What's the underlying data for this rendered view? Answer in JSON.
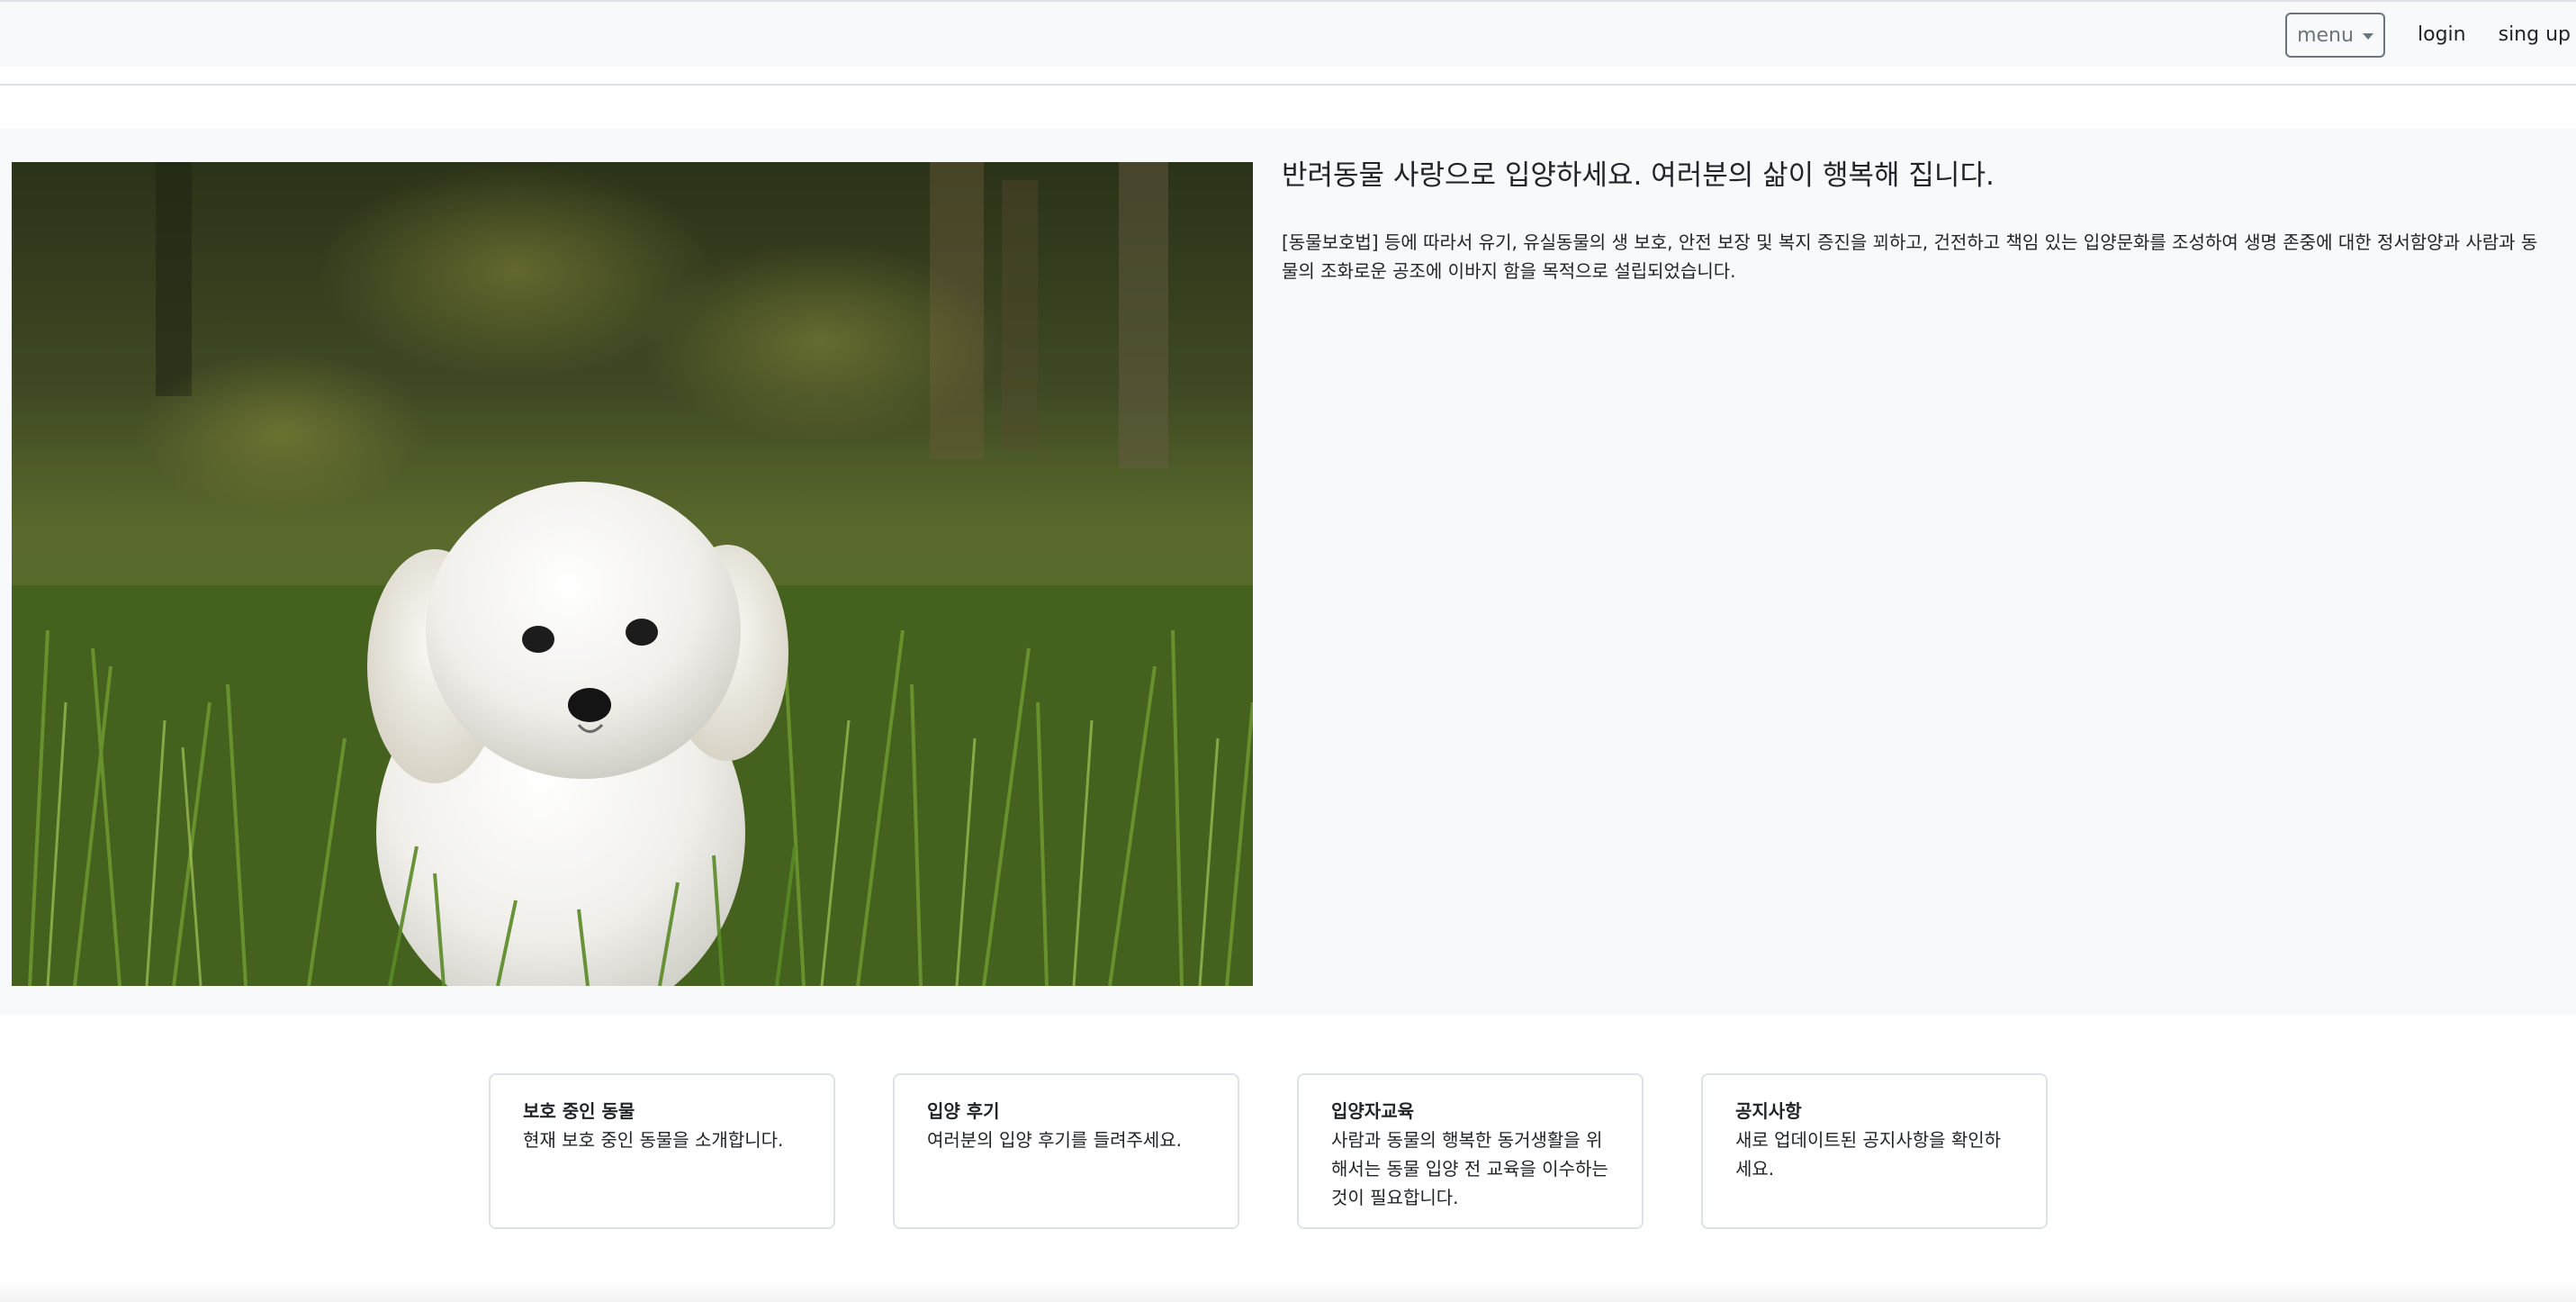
{
  "navbar": {
    "menu_label": "menu",
    "login_label": "login",
    "signup_label": "sing up"
  },
  "hero": {
    "title": "반려동물 사랑으로 입양하세요. 여러분의 삶이 행복해 집니다.",
    "description": "[동물보호법] 등에 따라서 유기, 유실동물의 생 보호, 안전 보장 및 복지 증진을 꾀하고, 건전하고 책임 있는 입양문화를 조성하여 생명 존중에 대한 정서함양과 사람과 동물의 조화로운 공조에 이바지 함을 목적으로 설립되었습니다."
  },
  "cards": [
    {
      "title": "보호 중인 동물",
      "text": "현재 보호 중인 동물을 소개합니다."
    },
    {
      "title": "입양 후기",
      "text": "여러분의 입양 후기를 들려주세요."
    },
    {
      "title": "입양자교육",
      "text": "사람과 동물의 행복한 동거생활을 위해서는 동물 입양 전 교육을 이수하는 것이 필요합니다."
    },
    {
      "title": "공지사항",
      "text": "새로 업데이트된 공지사항을 확인하세요."
    }
  ],
  "colors": {
    "navbar_bg": "#f8f9fa",
    "hero_bg": "#f8f9fa",
    "border": "#dee2e6",
    "secondary": "#6c757d",
    "text": "#212529"
  }
}
